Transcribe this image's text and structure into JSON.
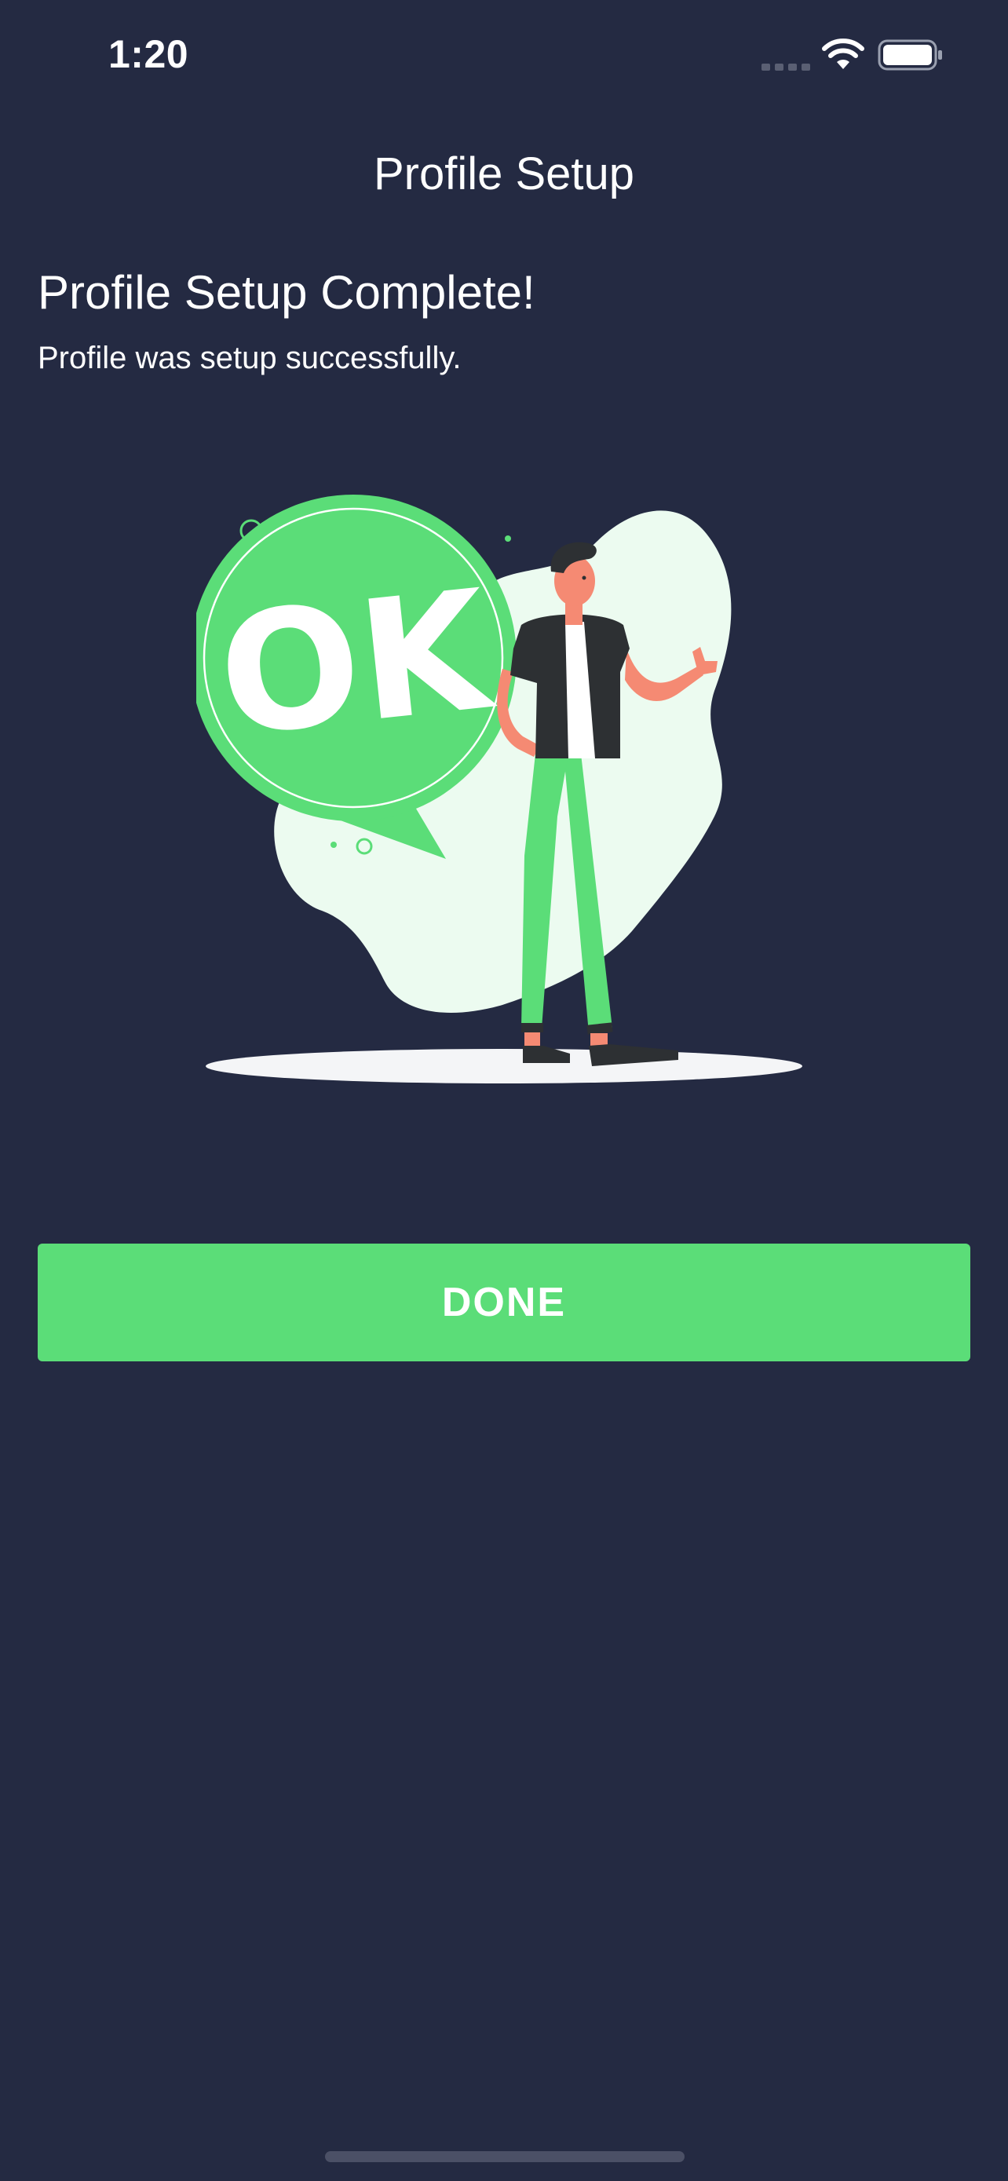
{
  "status_bar": {
    "time": "1:20",
    "icons": [
      "cellular-signal-icon",
      "wifi-icon",
      "battery-icon"
    ]
  },
  "nav": {
    "title": "Profile Setup"
  },
  "content": {
    "heading": "Profile Setup Complete!",
    "subheading": "Profile was setup successfully.",
    "illustration": {
      "badge_text": "OK",
      "description_icon": "ok-person-illustration"
    }
  },
  "actions": {
    "done_label": "DONE"
  },
  "colors": {
    "background": "#242a42",
    "accent": "#5bdd78",
    "text": "#ffffff",
    "blob": "#ecfbf0",
    "shirt": "#2d3033",
    "skin": "#f58a73"
  }
}
